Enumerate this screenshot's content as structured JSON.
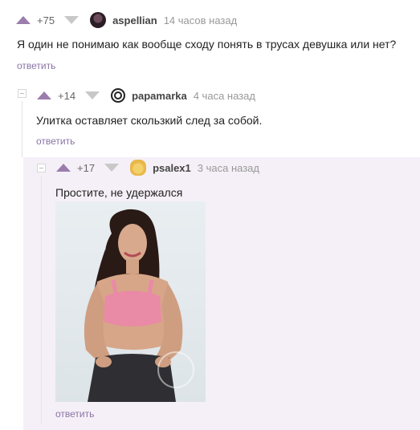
{
  "comments": [
    {
      "rating": "+75",
      "username": "aspellian",
      "time": "14 часов назад",
      "text": "Я один не понимаю как вообще сходу понять в трусах девушка или нет?",
      "reply": "ответить"
    },
    {
      "rating": "+14",
      "username": "papamarka",
      "time": "4 часа назад",
      "text": "Улитка оставляет скользкий след за собой.",
      "reply": "ответить"
    },
    {
      "rating": "+17",
      "username": "psalex1",
      "time": "3 часа назад",
      "text": "Простите, не удержался",
      "reply": "ответить"
    }
  ],
  "colors": {
    "accent": "#8a73a6",
    "vote_up": "#9b7dad",
    "vote_down": "#c8c8c8",
    "highlight": "#f5f0f7"
  },
  "icons": [
    "vote-up-icon",
    "vote-down-icon",
    "collapse-icon"
  ]
}
